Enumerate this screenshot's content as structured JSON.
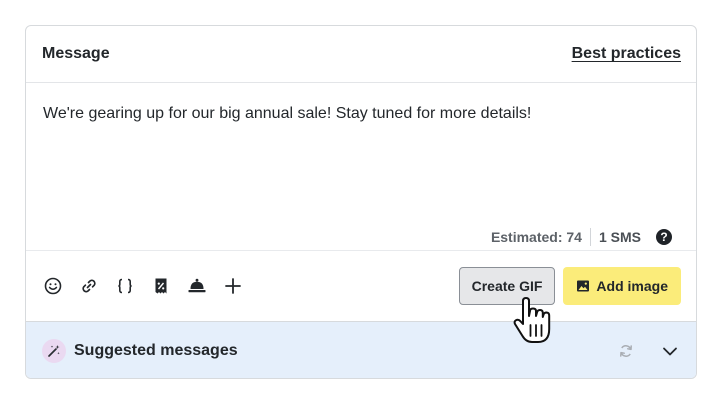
{
  "header": {
    "title": "Message",
    "best_practices": "Best practices"
  },
  "editor": {
    "message": "We're gearing up for our big annual sale! Stay tuned for more details!",
    "estimated": "Estimated: 74",
    "sms_count": "1 SMS",
    "help_symbol": "?"
  },
  "toolbar": {
    "tools": [
      "emoji-icon",
      "link-icon",
      "curly-braces-icon",
      "coupon-icon",
      "bell-icon",
      "plus-icon"
    ],
    "create_gif": "Create GIF",
    "add_image": "Add image"
  },
  "suggested": {
    "label": "Suggested messages"
  },
  "colors": {
    "accent_yellow": "#fbec7a",
    "suggest_bg": "#e5effb"
  }
}
